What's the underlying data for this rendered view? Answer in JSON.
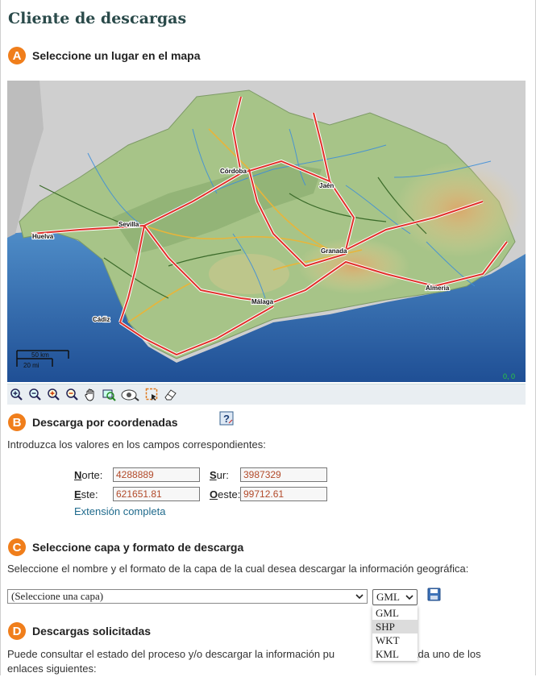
{
  "page": {
    "title": "Cliente de descargas"
  },
  "section_a": {
    "badge": "A",
    "title": "Seleccione un lugar en el mapa"
  },
  "map": {
    "cities": [
      "Córdoba",
      "Jaén",
      "Sevilla",
      "Huelva",
      "Granada",
      "Almeria",
      "Málaga",
      "Cádiz"
    ],
    "scale_km": "50 km",
    "scale_mi": "20 mi",
    "coord_readout": "0, 0"
  },
  "toolbar": {
    "tools": [
      "zoom-in",
      "zoom-out",
      "zoom-in-box",
      "zoom-out-box",
      "pan",
      "zoom-extent",
      "identify",
      "select",
      "eraser"
    ]
  },
  "section_b": {
    "badge": "B",
    "title": "Descarga por coordenadas",
    "intro": "Introduzca los valores en los campos correspondientes:"
  },
  "coords": {
    "norte_first": "N",
    "norte_rest": "orte:",
    "norte_value": "4288889",
    "sur_first": "S",
    "sur_rest": "ur:",
    "sur_value": "3987329",
    "este_first": "E",
    "este_rest": "ste:",
    "este_value": "621651.81",
    "oeste_first": "O",
    "oeste_rest": "este:",
    "oeste_value": "99712.61"
  },
  "extension_link": "Extensión completa",
  "section_c": {
    "badge": "C",
    "title": "Seleccione capa y formato de descarga",
    "intro": "Seleccione el nombre y el formato de la capa de la cual desea descargar la información geográfica:"
  },
  "layer_select": {
    "value": "(Seleccione una capa)"
  },
  "format_select": {
    "value": "GML",
    "options": [
      "GML",
      "SHP",
      "WKT",
      "KML"
    ],
    "highlighted": "SHP"
  },
  "section_d": {
    "badge": "D",
    "title": "Descargas solicitadas",
    "text_line1": "Puede consultar el estado del proceso y/o descargar la información pu",
    "text_line1_end": "obre cada uno de los",
    "text_line2": "enlaces siguientes:"
  },
  "colors": {
    "accent": "#f07e1b",
    "title": "#2a4a4a",
    "link": "#1f6a8c",
    "sea": "#2f6fb0",
    "land": "#a8c48a"
  }
}
